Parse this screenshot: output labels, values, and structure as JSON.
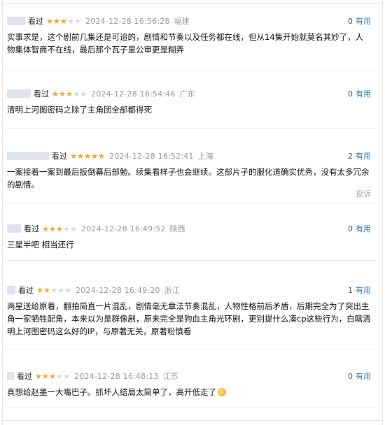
{
  "comments": [
    {
      "watched": "看过",
      "rating": 3,
      "date": "2024-12-28 16:56:28",
      "location": "福建",
      "useful_count": "0",
      "useful_label": "有用",
      "text": "实事求是，这个剧前几集还是可追的，剧情和节奏以及任务都在线，但从14集开始就莫名其妙了，人物集体智商不在线，最后那个瓦子里公审更是糊弄"
    },
    {
      "watched": "看过",
      "rating": 3,
      "date": "2024-12-28 16:54:46",
      "location": "广东",
      "useful_count": "0",
      "useful_label": "有用",
      "text": "清明上河图密码之除了主角团全部都得死"
    },
    {
      "watched": "看过",
      "rating": 5,
      "date": "2024-12-28 16:52:41",
      "location": "上海",
      "useful_count": "2",
      "useful_label": "有用",
      "text": "一案接着一案到最后扳倒幕后部勉。续集看样子也会继续。这部片子的服化道确实优秀，没有太多冗余的剧情。",
      "report": "投诉"
    },
    {
      "watched": "看过",
      "rating": 3,
      "date": "2024-12-28 16:49:52",
      "location": "陕西",
      "useful_count": "0",
      "useful_label": "有用",
      "text": "三星半吧 相当还行"
    },
    {
      "watched": "看过",
      "rating": 2,
      "date": "2024-12-28 16:49:20",
      "location": "浙江",
      "useful_count": "1",
      "useful_label": "有用",
      "text": "两星送给原着，翻拍简直一片混乱，剧情毫无章法节奏混乱，人物性格前后矛盾，后期完全为了突出主角一家牺牲配角，本来以为是群像剧，原来完全是狗血主角光环剧，更别提什么凑cp这些行为，白瞎清明上河图密码这么好的IP，与原著无关，原著粉慎看"
    },
    {
      "watched": "看过",
      "rating": 3,
      "date": "2024-12-28 16:48:13",
      "location": "江苏",
      "useful_count": "0",
      "useful_label": "有用",
      "text": "真想给赵墨一大嘴巴子。抓坏人结局太简单了，高开低走了",
      "emoji": "star-struck-emoji"
    }
  ],
  "star_glyph": "★",
  "colors": {
    "star_on": "#f5a623",
    "star_off": "#d8d8d8",
    "useful_link": "#3377aa",
    "meta_gray": "#9a9a9a"
  }
}
